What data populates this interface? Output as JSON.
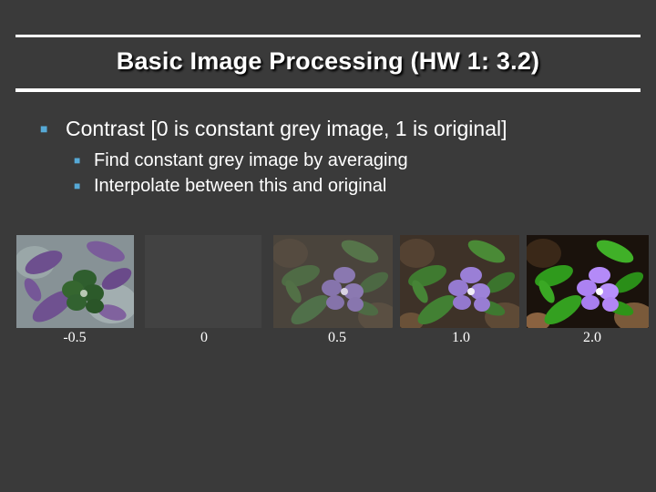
{
  "slide": {
    "title": "Basic Image Processing (HW 1: 3.2)",
    "bullets": [
      {
        "text": "Contrast [0 is constant grey image, 1 is original]",
        "sub": [
          "Find constant grey image by averaging",
          "Interpolate between this and original"
        ]
      }
    ],
    "images": [
      {
        "caption": "-0.5",
        "contrast": -0.5,
        "content": "purple-green flower photo with inverted contrast"
      },
      {
        "caption": "0",
        "contrast": 0,
        "content": "uniform grey image"
      },
      {
        "caption": "0.5",
        "contrast": 0.5,
        "content": "periwinkle flower photo, low contrast"
      },
      {
        "caption": "1.0",
        "contrast": 1.0,
        "content": "periwinkle flower photo, original"
      },
      {
        "caption": "2.0",
        "contrast": 2.0,
        "content": "periwinkle flower photo, high contrast"
      }
    ]
  },
  "colors": {
    "background": "#3a3a3a",
    "bullet_marker": "#56a9d6",
    "text": "#ffffff",
    "grey_image": "#424242"
  },
  "icons": {
    "bullet": "square-bullet-icon"
  }
}
